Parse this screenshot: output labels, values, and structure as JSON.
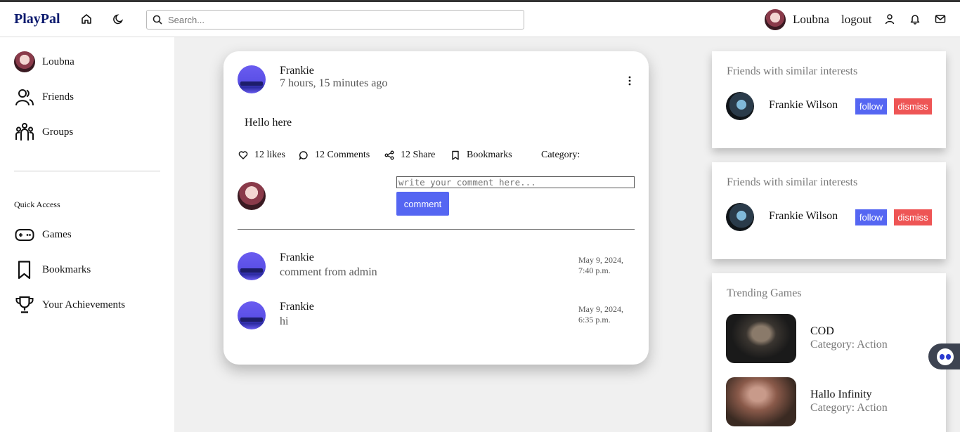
{
  "header": {
    "brand": "PlayPal",
    "search_placeholder": "Search...",
    "username": "Loubna",
    "logout_label": "logout"
  },
  "sidebar": {
    "items": [
      {
        "label": "Loubna"
      },
      {
        "label": "Friends"
      },
      {
        "label": "Groups"
      }
    ],
    "quick_access_title": "Quick Access",
    "quick_items": [
      {
        "label": "Games"
      },
      {
        "label": "Bookmarks"
      },
      {
        "label": "Your Achievements"
      }
    ]
  },
  "post": {
    "author": "Frankie",
    "time": "7 hours, 15 minutes ago",
    "text": "Hello here",
    "likes": "12 likes",
    "comments": "12 Comments",
    "shares": "12 Share",
    "bookmarks": "Bookmarks",
    "category": "Category:",
    "comment_placeholder": "write your comment here...",
    "comment_button": "comment",
    "comment_list": [
      {
        "author": "Frankie",
        "text": "comment from admin",
        "date_line1": "May 9, 2024,",
        "date_line2": "7:40 p.m."
      },
      {
        "author": "Frankie",
        "text": "hi",
        "date_line1": "May 9, 2024,",
        "date_line2": "6:35 p.m."
      }
    ]
  },
  "right": {
    "suggestions": [
      {
        "title": "Friends with similar interests",
        "name": "Frankie Wilson",
        "follow": "follow",
        "dismiss": "dismiss"
      },
      {
        "title": "Friends with similar interests",
        "name": "Frankie Wilson",
        "follow": "follow",
        "dismiss": "dismiss"
      }
    ],
    "trending": {
      "title": "Trending Games",
      "games": [
        {
          "name": "COD",
          "category": "Category: Action"
        },
        {
          "name": "Hallo Infinity",
          "category": "Category: Action"
        }
      ]
    }
  },
  "colors": {
    "brand": "#0b1a6e",
    "primary_button": "#5566f2",
    "dismiss_button": "#ee5555"
  }
}
